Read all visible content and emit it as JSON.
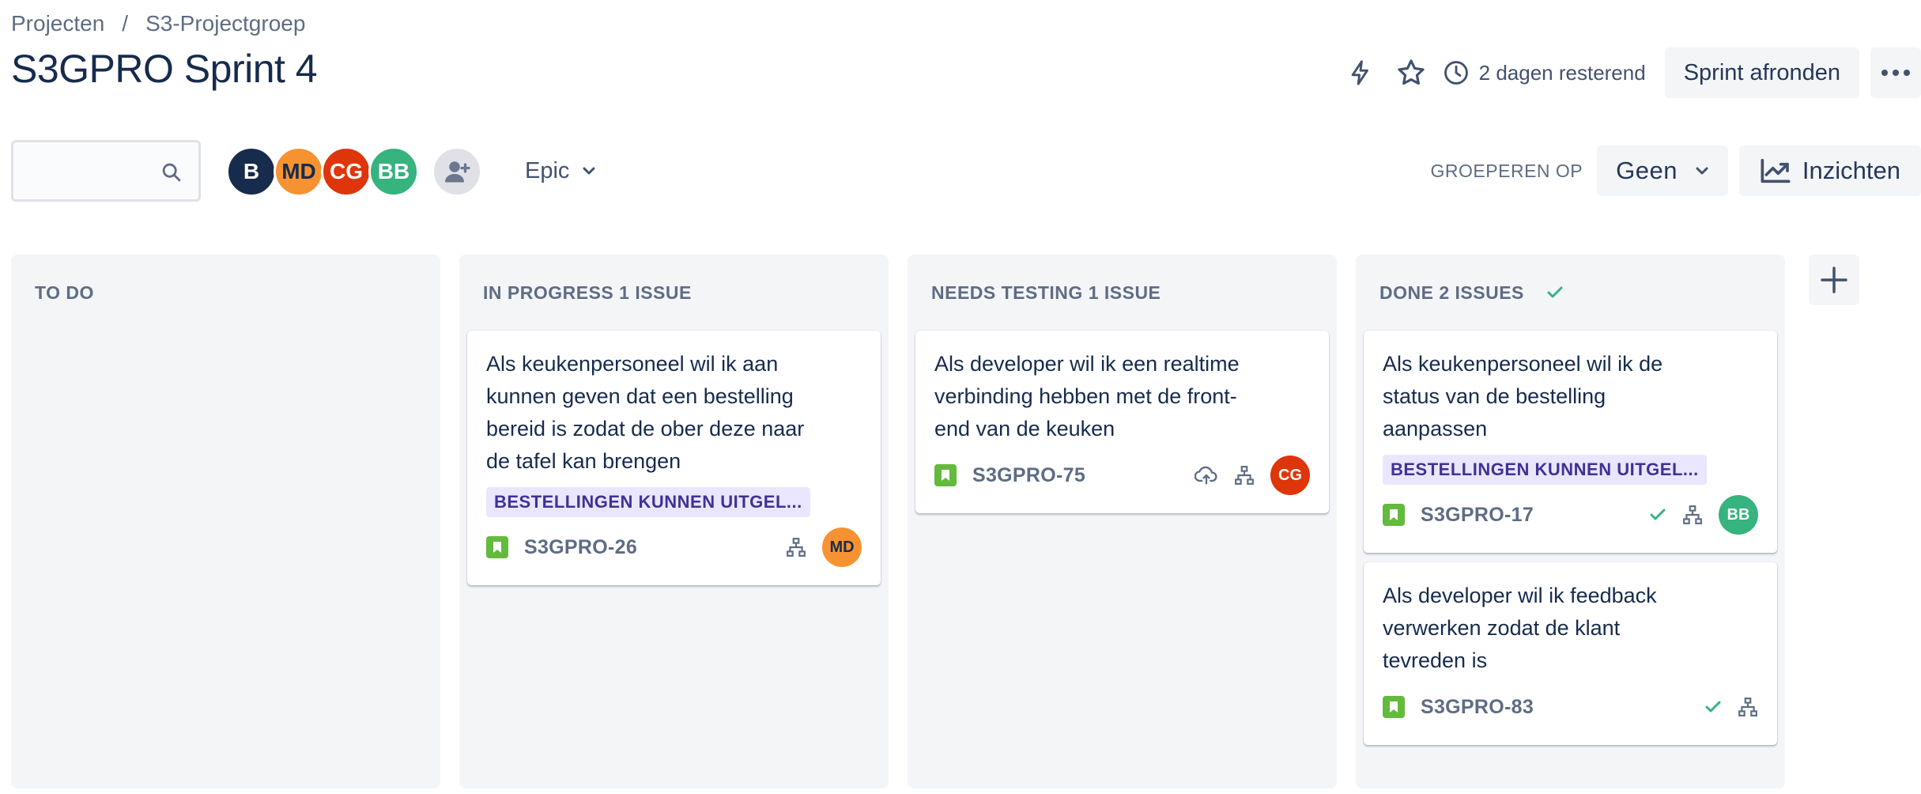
{
  "breadcrumb": {
    "items": [
      "Projecten",
      "S3-Projectgroep"
    ],
    "separator": "/"
  },
  "page_title": "S3GPRO Sprint 4",
  "header": {
    "time_remaining": "2 dagen resterend",
    "complete_sprint_label": "Sprint afronden",
    "icons": [
      "lightning-icon",
      "star-icon",
      "clock-icon",
      "more-icon"
    ]
  },
  "filters": {
    "search_placeholder": "",
    "avatars": [
      {
        "initials": "B",
        "color": "#172b4d"
      },
      {
        "initials": "MD",
        "color": "#f79232"
      },
      {
        "initials": "CG",
        "color": "#de350b"
      },
      {
        "initials": "BB",
        "color": "#36b37e"
      }
    ],
    "epic_label": "Epic",
    "group_by_label": "GROEPEREN OP",
    "group_by_value": "Geen",
    "insights_label": "Inzichten"
  },
  "columns": [
    {
      "title": "TO DO",
      "cards": []
    },
    {
      "title": "IN PROGRESS 1 ISSUE",
      "cards": [
        {
          "summary": "Als keukenpersoneel wil ik aan kunnen geven dat een bestelling bereid is zodat de ober deze naar de tafel kan brengen",
          "epic": "BESTELLINGEN KUNNEN UITGEL...",
          "key": "S3GPRO-26",
          "assignee": "MD"
        }
      ]
    },
    {
      "title": "NEEDS TESTING 1 ISSUE",
      "cards": [
        {
          "summary": "Als developer wil ik een realtime verbinding hebben met de front-end van de keuken",
          "key": "S3GPRO-75",
          "assignee": "CG"
        }
      ]
    },
    {
      "title": "DONE 2 ISSUES",
      "cards": [
        {
          "summary": "Als keukenpersoneel wil ik de status van de bestelling aanpassen",
          "epic": "BESTELLINGEN KUNNEN UITGEL...",
          "key": "S3GPRO-17",
          "assignee": "BB"
        },
        {
          "summary": "Als developer wil ik feedback verwerken zodat de klant tevreden is",
          "key": "S3GPRO-83"
        }
      ]
    }
  ],
  "colors": {
    "accent_done": "#36b37e",
    "story": "#63ba3c",
    "epic_bg": "#eae6ff",
    "epic_text": "#403294"
  }
}
